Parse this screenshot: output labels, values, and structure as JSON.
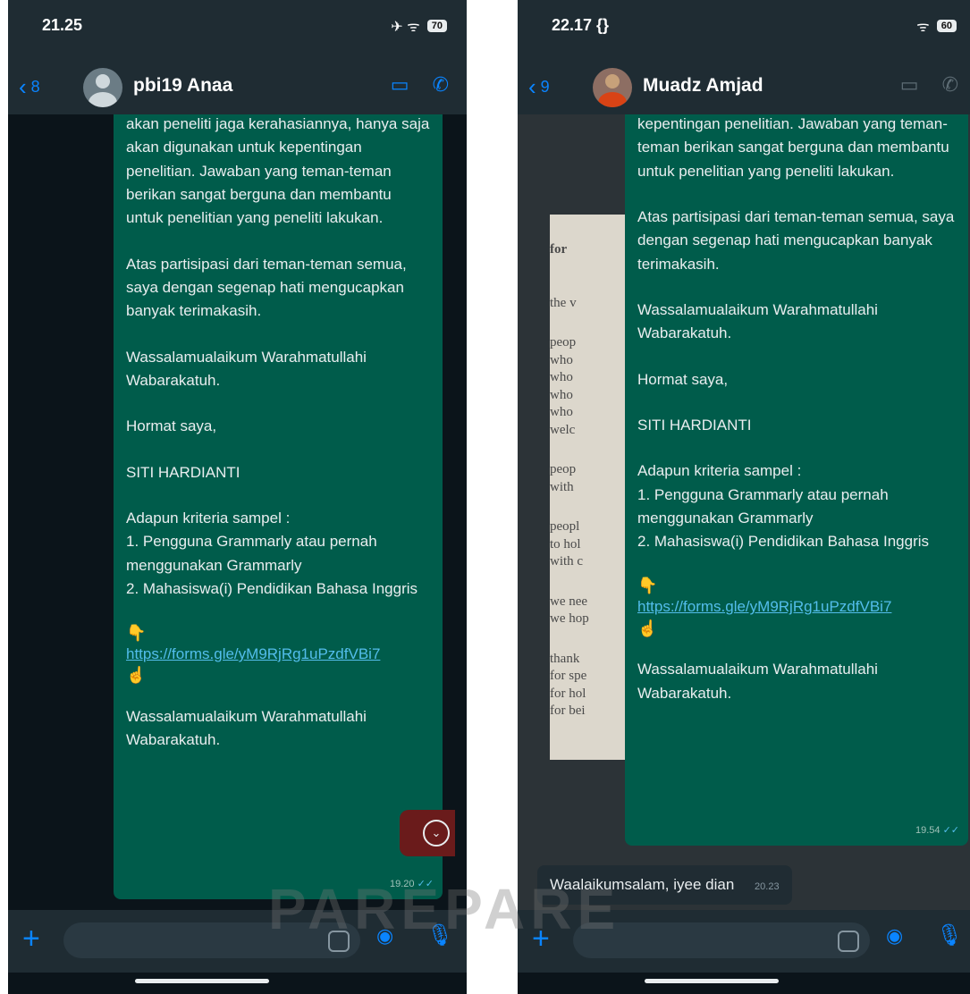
{
  "left_phone": {
    "status": {
      "time": "21.25",
      "signal": "✈ ᯤ",
      "battery": "70"
    },
    "header": {
      "back_count": "8",
      "contact_name": "pbi19 Anaa"
    },
    "message": {
      "paragraphs": [
        "akan peneliti jaga kerahasiannya, hanya saja akan digunakan untuk kepentingan penelitian. Jawaban yang teman-teman berikan sangat berguna dan membantu untuk penelitian yang peneliti lakukan.",
        "Atas partisipasi dari teman-teman semua, saya dengan segenap hati mengucapkan banyak terimakasih.",
        "Wassalamualaikum Warahmatullahi Wabarakatuh.",
        "Hormat saya,",
        "",
        "SITI HARDIANTI",
        "Adapun kriteria sampel :\n1. Pengguna Grammarly atau pernah menggunakan Grammarly\n2. Mahasiswa(i) Pendidikan Bahasa Inggris"
      ],
      "hand_down": "👇",
      "link": "https://forms.gle/yM9RjRg1uPzdfVBi7",
      "hand_up": "☝",
      "closing": "Wassalamualaikum Warahmatullahi Wabarakatuh.",
      "time": "19.20",
      "ticks": "✓✓"
    },
    "scroll_down": "⌄"
  },
  "right_phone": {
    "status": {
      "time": "22.17 {}",
      "signal": "ᯤ",
      "battery": "60"
    },
    "header": {
      "back_count": "9",
      "contact_name": "Muadz Amjad"
    },
    "background_paper_lines": [
      "for",
      "the v",
      "peop",
      "who",
      "who",
      "who",
      "who",
      "welc",
      "peop",
      "with",
      "peopl",
      "to hol",
      "with c",
      "we nee",
      "we hop",
      "thank",
      "for spe",
      "for hol",
      "for bei"
    ],
    "message": {
      "paragraphs": [
        "kepentingan penelitian. Jawaban yang teman-teman berikan sangat berguna dan membantu untuk penelitian yang peneliti lakukan.",
        "Atas partisipasi dari teman-teman semua, saya dengan segenap hati mengucapkan banyak terimakasih.",
        "Wassalamualaikum Warahmatullahi Wabarakatuh.",
        "Hormat saya,",
        "",
        "SITI HARDIANTI",
        "Adapun kriteria sampel :\n1. Pengguna Grammarly atau pernah menggunakan Grammarly\n2. Mahasiswa(i) Pendidikan Bahasa Inggris"
      ],
      "hand_down": "👇",
      "link": "https://forms.gle/yM9RjRg1uPzdfVBi7",
      "hand_up": "☝",
      "closing": "Wassalamualaikum Warahmatullahi Wabarakatuh.",
      "time": "19.54",
      "ticks": "✓✓"
    },
    "reply": {
      "text": "Waalaikumsalam, iyee dian",
      "time": "20.23"
    }
  },
  "watermark": "PAREPARE",
  "icons": {
    "back": "chevron-left-icon",
    "video": "video-camera-icon",
    "phone": "phone-icon",
    "plus": "plus-icon",
    "sticker": "sticker-icon",
    "camera": "camera-icon",
    "mic": "microphone-icon"
  }
}
